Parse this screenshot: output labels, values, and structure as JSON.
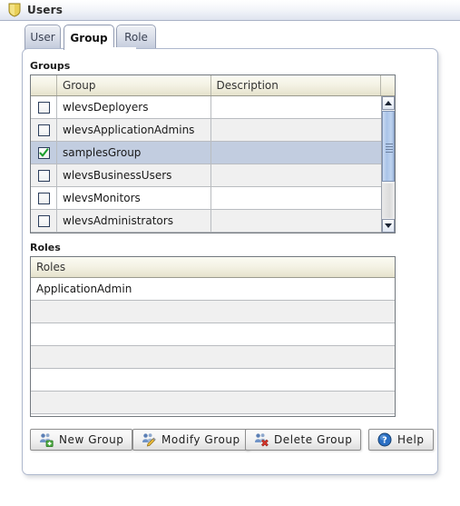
{
  "window": {
    "title": "Users",
    "icon": "shield-icon"
  },
  "tabs": [
    {
      "label": "User",
      "active": false
    },
    {
      "label": "Group",
      "active": true
    },
    {
      "label": "Role",
      "active": false
    }
  ],
  "groups_section": {
    "title": "Groups",
    "columns": [
      "",
      "Group",
      "Description",
      ""
    ],
    "rows": [
      {
        "checked": false,
        "group": "wlevsDeployers",
        "description": ""
      },
      {
        "checked": false,
        "group": "wlevsApplicationAdmins",
        "description": ""
      },
      {
        "checked": true,
        "group": "samplesGroup",
        "description": ""
      },
      {
        "checked": false,
        "group": "wlevsBusinessUsers",
        "description": ""
      },
      {
        "checked": false,
        "group": "wlevsMonitors",
        "description": ""
      },
      {
        "checked": false,
        "group": "wlevsAdministrators",
        "description": ""
      }
    ],
    "scrollbar": {
      "up_arrow": "scroll-up-icon",
      "down_arrow": "scroll-down-icon"
    }
  },
  "roles_section": {
    "title": "Roles",
    "columns": [
      "Roles"
    ],
    "rows": [
      {
        "role": "ApplicationAdmin"
      },
      {
        "role": ""
      },
      {
        "role": ""
      },
      {
        "role": ""
      },
      {
        "role": ""
      },
      {
        "role": ""
      }
    ]
  },
  "buttons": [
    {
      "label": "New Group",
      "icon": "users-add-icon"
    },
    {
      "label": "Modify Group",
      "icon": "users-edit-icon"
    },
    {
      "label": "Delete Group",
      "icon": "users-delete-icon"
    },
    {
      "label": "Help",
      "icon": "help-icon"
    }
  ],
  "colors": {
    "selected_row": "#c2cde0",
    "header_gradient_top": "#fbfbf3",
    "header_gradient_bottom": "#e5e2cc",
    "panel_border": "#aeb8cd",
    "checkmark_green": "#1a9e2e",
    "shield_gold": "#e8c84a",
    "help_blue": "#2a6fc4",
    "delete_red": "#d8352a"
  }
}
